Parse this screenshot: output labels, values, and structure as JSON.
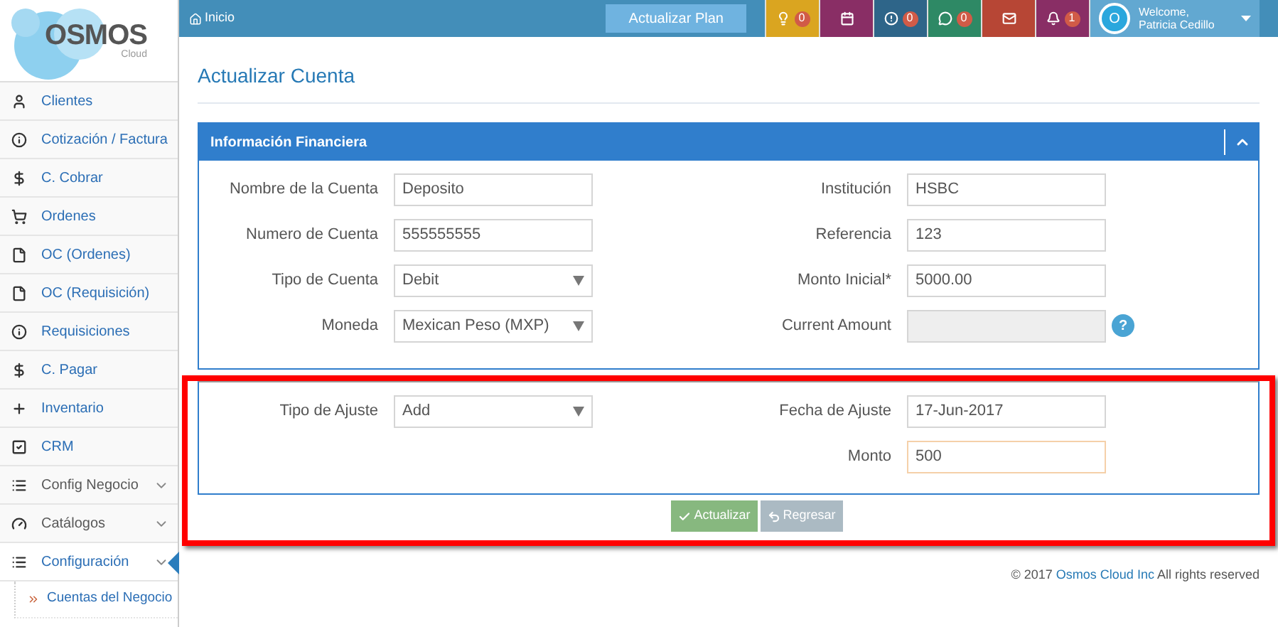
{
  "logo": {
    "name": "OSMOS",
    "sub": "Cloud"
  },
  "sidebar": {
    "items": [
      {
        "label": "Clientes",
        "expandable": false,
        "selected": false
      },
      {
        "label": "Cotización / Factura",
        "expandable": false,
        "selected": false
      },
      {
        "label": "C. Cobrar",
        "expandable": false,
        "selected": false
      },
      {
        "label": "Ordenes",
        "expandable": false,
        "selected": false
      },
      {
        "label": "OC (Ordenes)",
        "expandable": false,
        "selected": false
      },
      {
        "label": "OC (Requisición)",
        "expandable": false,
        "selected": false
      },
      {
        "label": "Requisiciones",
        "expandable": false,
        "selected": false
      },
      {
        "label": "C. Pagar",
        "expandable": false,
        "selected": false
      },
      {
        "label": "Inventario",
        "expandable": false,
        "selected": false
      },
      {
        "label": "CRM",
        "expandable": false,
        "selected": false
      },
      {
        "label": "Config Negocio",
        "expandable": true,
        "selected": false
      },
      {
        "label": "Catálogos",
        "expandable": true,
        "selected": false
      },
      {
        "label": "Configuración",
        "expandable": true,
        "selected": true,
        "children": [
          {
            "label": "Cuentas del Negocio"
          }
        ]
      }
    ]
  },
  "topbar": {
    "home": "Inicio",
    "plan_button": "Actualizar Plan",
    "tiles": [
      {
        "color": "#daa520",
        "badge": "0"
      },
      {
        "color": "#892e65"
      },
      {
        "color": "#2e6589",
        "badge": "0"
      },
      {
        "color": "#2e8965",
        "badge": "0"
      },
      {
        "color": "#b74635"
      },
      {
        "color": "#892e65",
        "badge": "1"
      }
    ],
    "user": {
      "avatar": "O",
      "greeting": "Welcome,",
      "name": "Patricia Cedillo"
    }
  },
  "page_title": "Actualizar Cuenta",
  "panel": {
    "title": "Información Financiera",
    "left": [
      {
        "label": "Nombre de la Cuenta",
        "value": "Deposito",
        "kind": "text"
      },
      {
        "label": "Numero de Cuenta",
        "value": "555555555",
        "kind": "text"
      },
      {
        "label": "Tipo de Cuenta",
        "value": "Debit",
        "kind": "select"
      },
      {
        "label": "Moneda",
        "value": "Mexican Peso (MXP)",
        "kind": "select"
      }
    ],
    "right": [
      {
        "label": "Institución",
        "value": "HSBC",
        "kind": "text"
      },
      {
        "label": "Referencia",
        "value": "123",
        "kind": "text"
      },
      {
        "label": "Monto Inicial*",
        "value": "5000.00",
        "kind": "text"
      },
      {
        "label": "Current Amount",
        "kind": "disabled",
        "help": "?"
      }
    ],
    "adjust_left": [
      {
        "label": "Tipo de Ajuste",
        "value": "Add",
        "kind": "select"
      }
    ],
    "adjust_right": [
      {
        "label": "Fecha de Ajuste",
        "value": "17-Jun-2017",
        "kind": "text",
        "focused": false
      },
      {
        "label": "Monto",
        "value": "500",
        "kind": "text",
        "focused": true
      }
    ]
  },
  "buttons": [
    {
      "label": "Actualizar",
      "kind": "primary"
    },
    {
      "label": "Regresar",
      "kind": "back"
    }
  ],
  "footer": {
    "prefix": "© 2017",
    "link": "Osmos Cloud Inc",
    "suffix": "All rights reserved"
  }
}
